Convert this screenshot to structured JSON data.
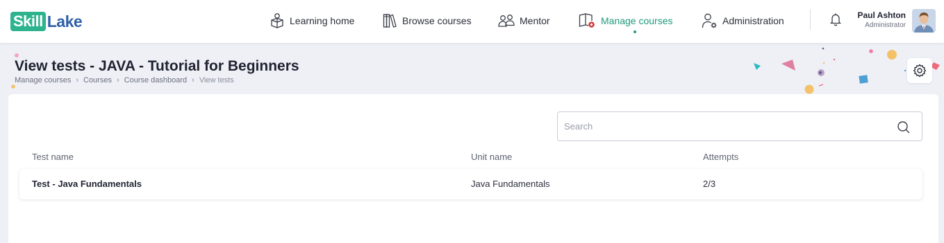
{
  "brand": {
    "logo_part1": "Skill",
    "logo_part2": "Lake",
    "accent": "#1f9a7d",
    "logo_green": "#2eb38f",
    "logo_blue": "#2f5fa8"
  },
  "nav": {
    "items": [
      {
        "label": "Learning home",
        "icon": "learning-home-icon",
        "active": false
      },
      {
        "label": "Browse courses",
        "icon": "books-icon",
        "active": false
      },
      {
        "label": "Mentor",
        "icon": "mentor-icon",
        "active": false
      },
      {
        "label": "Manage courses",
        "icon": "manage-courses-icon",
        "active": true
      },
      {
        "label": "Administration",
        "icon": "admin-user-icon",
        "active": false
      }
    ]
  },
  "user": {
    "name": "Paul Ashton",
    "role": "Administrator"
  },
  "page": {
    "title": "View tests - JAVA - Tutorial for Beginners",
    "breadcrumb": [
      "Manage courses",
      "Courses",
      "Course dashboard",
      "View tests"
    ]
  },
  "search": {
    "placeholder": "Search",
    "value": ""
  },
  "table": {
    "columns": [
      "Test name",
      "Unit name",
      "Attempts"
    ],
    "rows": [
      {
        "test_name": "Test - Java Fundamentals",
        "unit_name": "Java Fundamentals",
        "attempts": "2/3"
      }
    ]
  }
}
